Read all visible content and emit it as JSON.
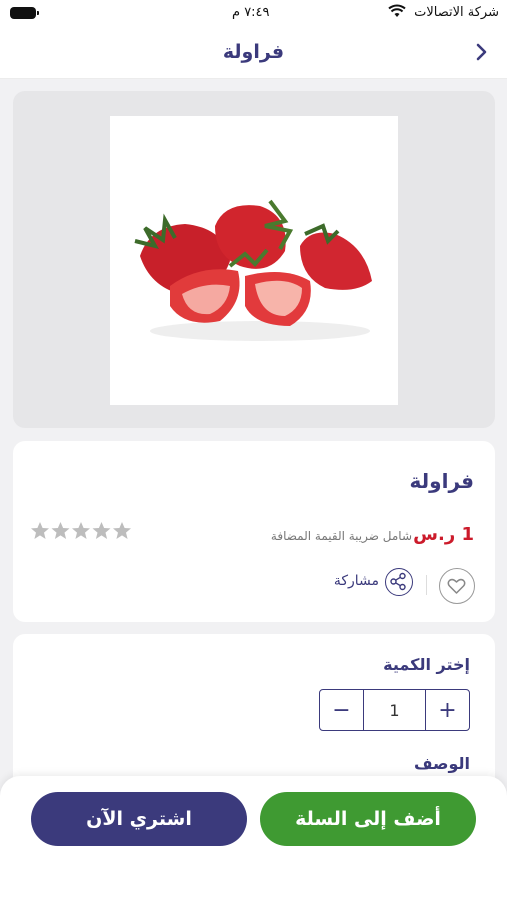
{
  "status_bar": {
    "carrier": "شركة الاتصالات",
    "time": "٧:٤٩ م"
  },
  "header": {
    "title": "فراولة"
  },
  "product": {
    "name": "فراولة",
    "price": "1 ر.س",
    "vat_note": "شامل ضريبة القيمة المضافة",
    "rating": 0,
    "rating_max": 5,
    "share_label": "مشاركة"
  },
  "quantity": {
    "label": "إختر الكمية",
    "value": "1",
    "minus": "−",
    "plus": "+"
  },
  "description": {
    "label": "الوصف"
  },
  "actions": {
    "add_to_cart": "أضف إلى السلة",
    "buy_now": "اشتري الآن"
  },
  "colors": {
    "brand": "#3b3a7c",
    "price": "#cc1b2b",
    "add_button": "#3f9a32",
    "buy_button": "#3b3a7c"
  }
}
